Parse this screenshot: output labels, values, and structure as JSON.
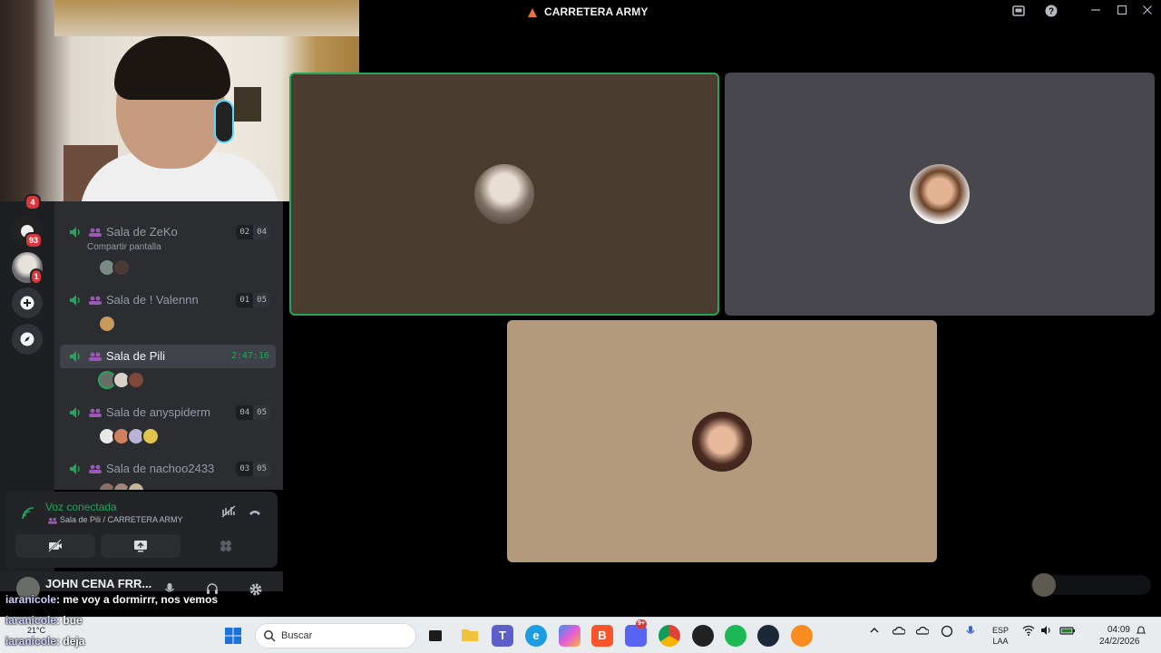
{
  "window": {
    "title": "CARRETERA ARMY"
  },
  "servers": [
    {
      "badge": "4"
    },
    {
      "badge": "93"
    },
    {
      "badge": "1"
    }
  ],
  "voice_channels": [
    {
      "name": "Sala de ZeKo",
      "count_current": "02",
      "count_max": "04",
      "subtitle": "Compartir pantalla"
    },
    {
      "name": "Sala de ! Valennn",
      "count_current": "01",
      "count_max": "05"
    },
    {
      "name": "Sala de Pili",
      "timer": "2:47:16"
    },
    {
      "name": "Sala de anyspiderm",
      "count_current": "04",
      "count_max": "05"
    },
    {
      "name": "Sala de nachoo2433",
      "count_current": "03",
      "count_max": "05"
    }
  ],
  "voice_panel": {
    "status": "Voz conectada",
    "location": "Sala de Pili / CARRETERA ARMY"
  },
  "user_panel": {
    "username": "JOHN CENA FRR..."
  },
  "chat_overlay": [
    {
      "user": "iaranicole",
      "message": ": me voy a dormirrr, nos vemos"
    },
    {
      "user": "iaranicole",
      "message": ": bue"
    },
    {
      "user": "iaranicole",
      "message": ": deja"
    }
  ],
  "taskbar": {
    "search_placeholder": "Buscar",
    "weather": "21°C",
    "lang_1": "ESP",
    "lang_2": "LAA",
    "time": "04:09",
    "date": "24/2/2026",
    "discord_badge": "9+"
  },
  "colors": {
    "background": "#000000",
    "sidebar": "#2b2d31",
    "rail": "#1e1f22",
    "accent_green": "#23a55a",
    "tile_speaking_border": "#23a55a"
  }
}
